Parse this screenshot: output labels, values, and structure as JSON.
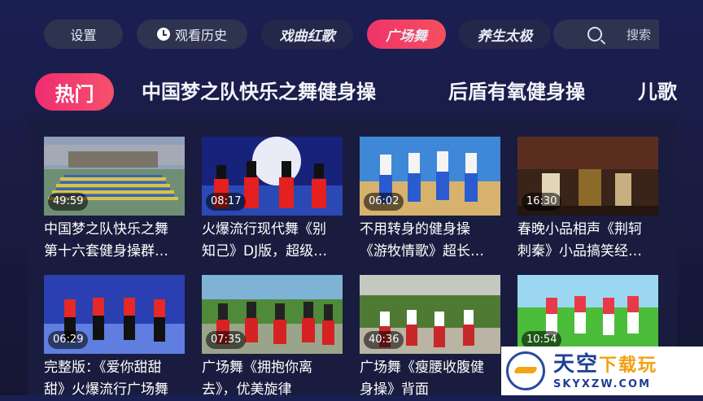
{
  "topnav": {
    "settings": "设置",
    "history": "观看历史",
    "opera": "戏曲红歌",
    "square_dance": "广场舞",
    "health": "养生太极",
    "search_label": "搜索",
    "history_icon": "clock-icon",
    "search_icon": "search-icon"
  },
  "categories": {
    "active": "热门",
    "items": [
      "中国梦之队快乐之舞健身操",
      "后盾有氧健身操",
      "儿歌"
    ]
  },
  "videos": [
    {
      "duration": "49:59",
      "title": "中国梦之队快乐之舞\n第十六套健身操群…"
    },
    {
      "duration": "08:17",
      "title": "火爆流行现代舞《别\n知己》DJ版，超级…"
    },
    {
      "duration": "06:02",
      "title": "不用转身的健身操\n《游牧情歌》超长…"
    },
    {
      "duration": "16:30",
      "title": "春晚小品相声《荆轲\n刺秦》小品搞笑经…"
    },
    {
      "duration": "06:29",
      "title": "完整版：《爱你甜甜\n甜》火爆流行广场舞"
    },
    {
      "duration": "07:35",
      "title": "广场舞《拥抱你离\n去》，优美旋律"
    },
    {
      "duration": "40:36",
      "title": "广场舞《瘦腰收腹健\n身操》背面"
    },
    {
      "duration": "10:54",
      "title": ""
    }
  ],
  "watermark": {
    "main": "天空",
    "accent": "下载玩",
    "url": "SKYXZW.COM"
  },
  "colors": {
    "accent": "#f0336a",
    "background": "#1a1f52",
    "pill": "#2e3350"
  }
}
